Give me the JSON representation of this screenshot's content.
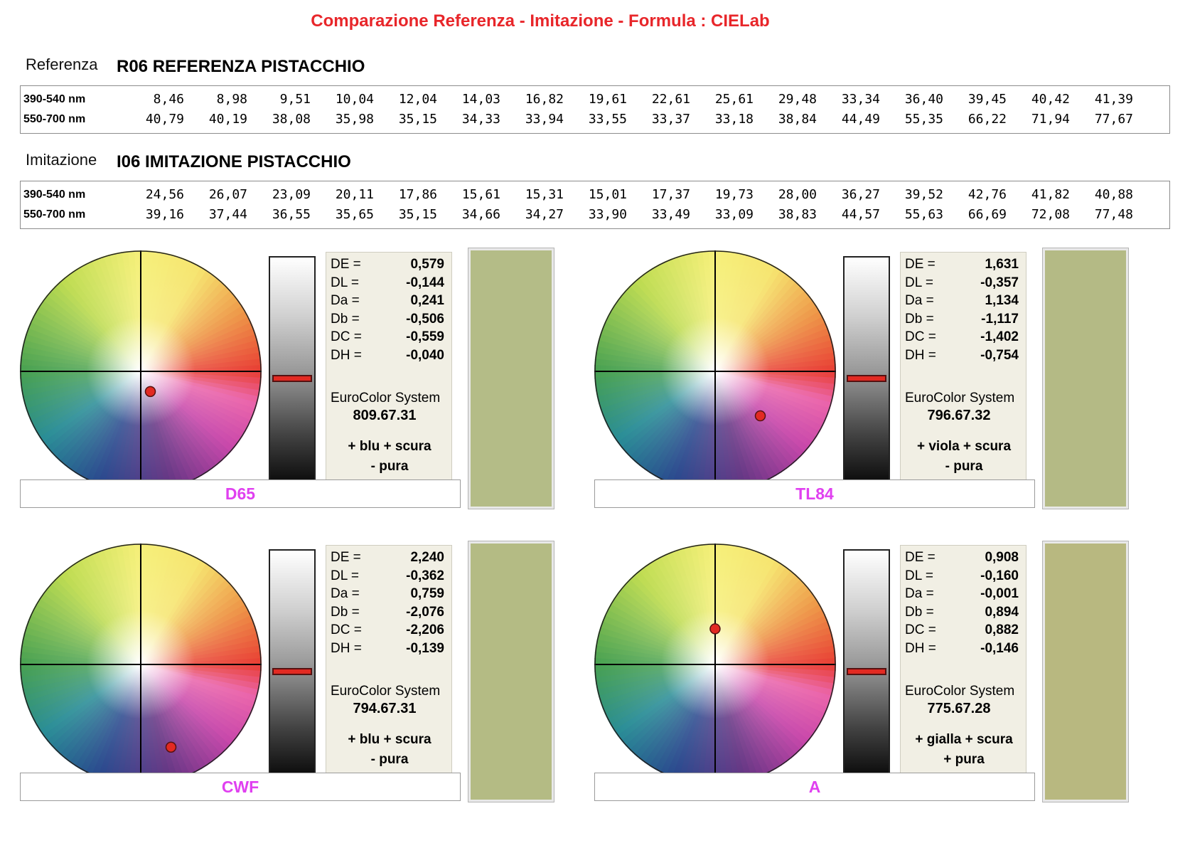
{
  "title": "Comparazione Referenza - Imitazione - Formula : CIELab",
  "referenza": {
    "label": "Referenza",
    "name": "R06 REFERENZA PISTACCHIO",
    "rows": [
      {
        "label": "390-540 nm",
        "values": [
          "8,46",
          "8,98",
          "9,51",
          "10,04",
          "12,04",
          "14,03",
          "16,82",
          "19,61",
          "22,61",
          "25,61",
          "29,48",
          "33,34",
          "36,40",
          "39,45",
          "40,42",
          "41,39"
        ]
      },
      {
        "label": "550-700 nm",
        "values": [
          "40,79",
          "40,19",
          "38,08",
          "35,98",
          "35,15",
          "34,33",
          "33,94",
          "33,55",
          "33,37",
          "33,18",
          "38,84",
          "44,49",
          "55,35",
          "66,22",
          "71,94",
          "77,67"
        ]
      }
    ]
  },
  "imitazione": {
    "label": "Imitazione",
    "name": "I06 IMITAZIONE PISTACCHIO",
    "rows": [
      {
        "label": "390-540 nm",
        "values": [
          "24,56",
          "26,07",
          "23,09",
          "20,11",
          "17,86",
          "15,61",
          "15,31",
          "15,01",
          "17,37",
          "19,73",
          "28,00",
          "36,27",
          "39,52",
          "42,76",
          "41,82",
          "40,88"
        ]
      },
      {
        "label": "550-700 nm",
        "values": [
          "39,16",
          "37,44",
          "36,55",
          "35,65",
          "35,15",
          "34,66",
          "34,27",
          "33,90",
          "33,49",
          "33,09",
          "38,83",
          "44,57",
          "55,63",
          "66,69",
          "72,08",
          "77,48"
        ]
      }
    ]
  },
  "panels": [
    {
      "illuminant": "D65",
      "metrics": [
        {
          "label": "DE =",
          "value": "0,579"
        },
        {
          "label": "DL =",
          "value": "-0,144"
        },
        {
          "label": "Da =",
          "value": "0,241"
        },
        {
          "label": "Db =",
          "value": "-0,506"
        },
        {
          "label": "DC =",
          "value": "-0,559"
        },
        {
          "label": "DH =",
          "value": "-0,040"
        }
      ],
      "system_label": "EuroColor System",
      "system_code": "809.67.31",
      "desc1": "+ blu + scura",
      "desc2": "- pura",
      "swatch_color": "#b4bc87",
      "lightness_fraction": 0.53,
      "dot_da": 0.241,
      "dot_db": -0.506
    },
    {
      "illuminant": "TL84",
      "metrics": [
        {
          "label": "DE =",
          "value": "1,631"
        },
        {
          "label": "DL =",
          "value": "-0,357"
        },
        {
          "label": "Da =",
          "value": "1,134"
        },
        {
          "label": "Db =",
          "value": "-1,117"
        },
        {
          "label": "DC =",
          "value": "-1,402"
        },
        {
          "label": "DH =",
          "value": "-0,754"
        }
      ],
      "system_label": "EuroColor System",
      "system_code": "796.67.32",
      "desc1": "+ viola + scura",
      "desc2": "- pura",
      "swatch_color": "#b4ba85",
      "lightness_fraction": 0.53,
      "dot_da": 1.134,
      "dot_db": -1.117
    },
    {
      "illuminant": "CWF",
      "metrics": [
        {
          "label": "DE =",
          "value": "2,240"
        },
        {
          "label": "DL =",
          "value": "-0,362"
        },
        {
          "label": "Da =",
          "value": "0,759"
        },
        {
          "label": "Db =",
          "value": "-2,076"
        },
        {
          "label": "DC =",
          "value": "-2,206"
        },
        {
          "label": "DH =",
          "value": "-0,139"
        }
      ],
      "system_label": "EuroColor System",
      "system_code": "794.67.31",
      "desc1": "+ blu + scura",
      "desc2": "- pura",
      "swatch_color": "#b4bb84",
      "lightness_fraction": 0.53,
      "dot_da": 0.759,
      "dot_db": -2.076
    },
    {
      "illuminant": "A",
      "metrics": [
        {
          "label": "DE =",
          "value": "0,908"
        },
        {
          "label": "DL =",
          "value": "-0,160"
        },
        {
          "label": "Da =",
          "value": "-0,001"
        },
        {
          "label": "Db =",
          "value": "0,894"
        },
        {
          "label": "DC =",
          "value": "0,882"
        },
        {
          "label": "DH =",
          "value": "-0,146"
        }
      ],
      "system_label": "EuroColor System",
      "system_code": "775.67.28",
      "desc1": "+ gialla + scura",
      "desc2": "+ pura",
      "swatch_color": "#b8b880",
      "lightness_fraction": 0.53,
      "dot_da": -0.001,
      "dot_db": 0.894
    }
  ],
  "colors": {
    "title": "#e8262a",
    "illuminant": "#e040f0",
    "marker": "#e22a22",
    "values_bg": "#f1efe4"
  }
}
